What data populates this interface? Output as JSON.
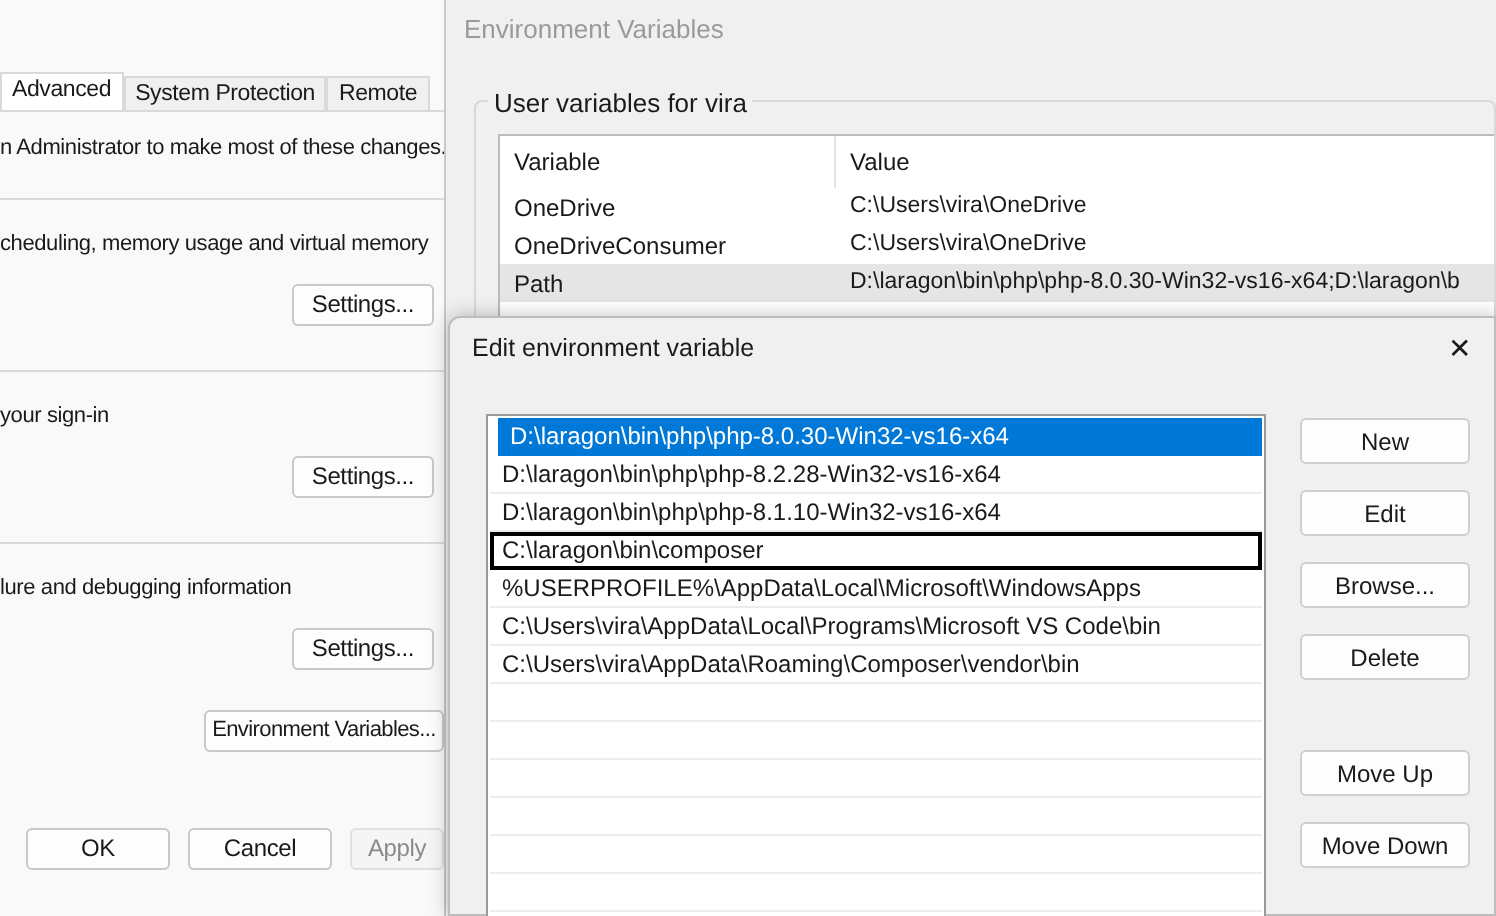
{
  "system_properties": {
    "tabs": [
      {
        "label": "Advanced",
        "selected": true
      },
      {
        "label": "System Protection",
        "selected": false
      },
      {
        "label": "Remote",
        "selected": false
      }
    ],
    "admin_note": "n Administrator to make most of these changes.",
    "sections": [
      {
        "text": "cheduling, memory usage and virtual memory",
        "button": "Settings..."
      },
      {
        "text": "your sign-in",
        "button": "Settings..."
      },
      {
        "text": "lure and debugging information",
        "button": "Settings..."
      }
    ],
    "env_button": "Environment Variables...",
    "footer_buttons": [
      {
        "label": "OK",
        "disabled": false
      },
      {
        "label": "Cancel",
        "disabled": false
      },
      {
        "label": "Apply",
        "disabled": true
      }
    ]
  },
  "environment_variables": {
    "title": "Environment Variables",
    "group_label": "User variables for vira",
    "columns": [
      "Variable",
      "Value"
    ],
    "rows": [
      {
        "variable": "OneDrive",
        "value": "C:\\Users\\vira\\OneDrive",
        "selected": false
      },
      {
        "variable": "OneDriveConsumer",
        "value": "C:\\Users\\vira\\OneDrive",
        "selected": false
      },
      {
        "variable": "Path",
        "value": "D:\\laragon\\bin\\php\\php-8.0.30-Win32-vs16-x64;D:\\laragon\\b",
        "selected": true
      }
    ]
  },
  "edit_dialog": {
    "title": "Edit environment variable",
    "close": "✕",
    "entries": [
      {
        "text": "D:\\laragon\\bin\\php\\php-8.0.30-Win32-vs16-x64",
        "selected": true,
        "focused": false
      },
      {
        "text": "D:\\laragon\\bin\\php\\php-8.2.28-Win32-vs16-x64",
        "selected": false,
        "focused": false
      },
      {
        "text": "D:\\laragon\\bin\\php\\php-8.1.10-Win32-vs16-x64",
        "selected": false,
        "focused": false
      },
      {
        "text": "C:\\laragon\\bin\\composer",
        "selected": false,
        "focused": true
      },
      {
        "text": "%USERPROFILE%\\AppData\\Local\\Microsoft\\WindowsApps",
        "selected": false,
        "focused": false
      },
      {
        "text": "C:\\Users\\vira\\AppData\\Local\\Programs\\Microsoft VS Code\\bin",
        "selected": false,
        "focused": false
      },
      {
        "text": "C:\\Users\\vira\\AppData\\Roaming\\Composer\\vendor\\bin",
        "selected": false,
        "focused": false
      }
    ],
    "buttons": [
      "New",
      "Edit",
      "Browse...",
      "Delete"
    ],
    "order_buttons": [
      "Move Up",
      "Move Down"
    ]
  }
}
